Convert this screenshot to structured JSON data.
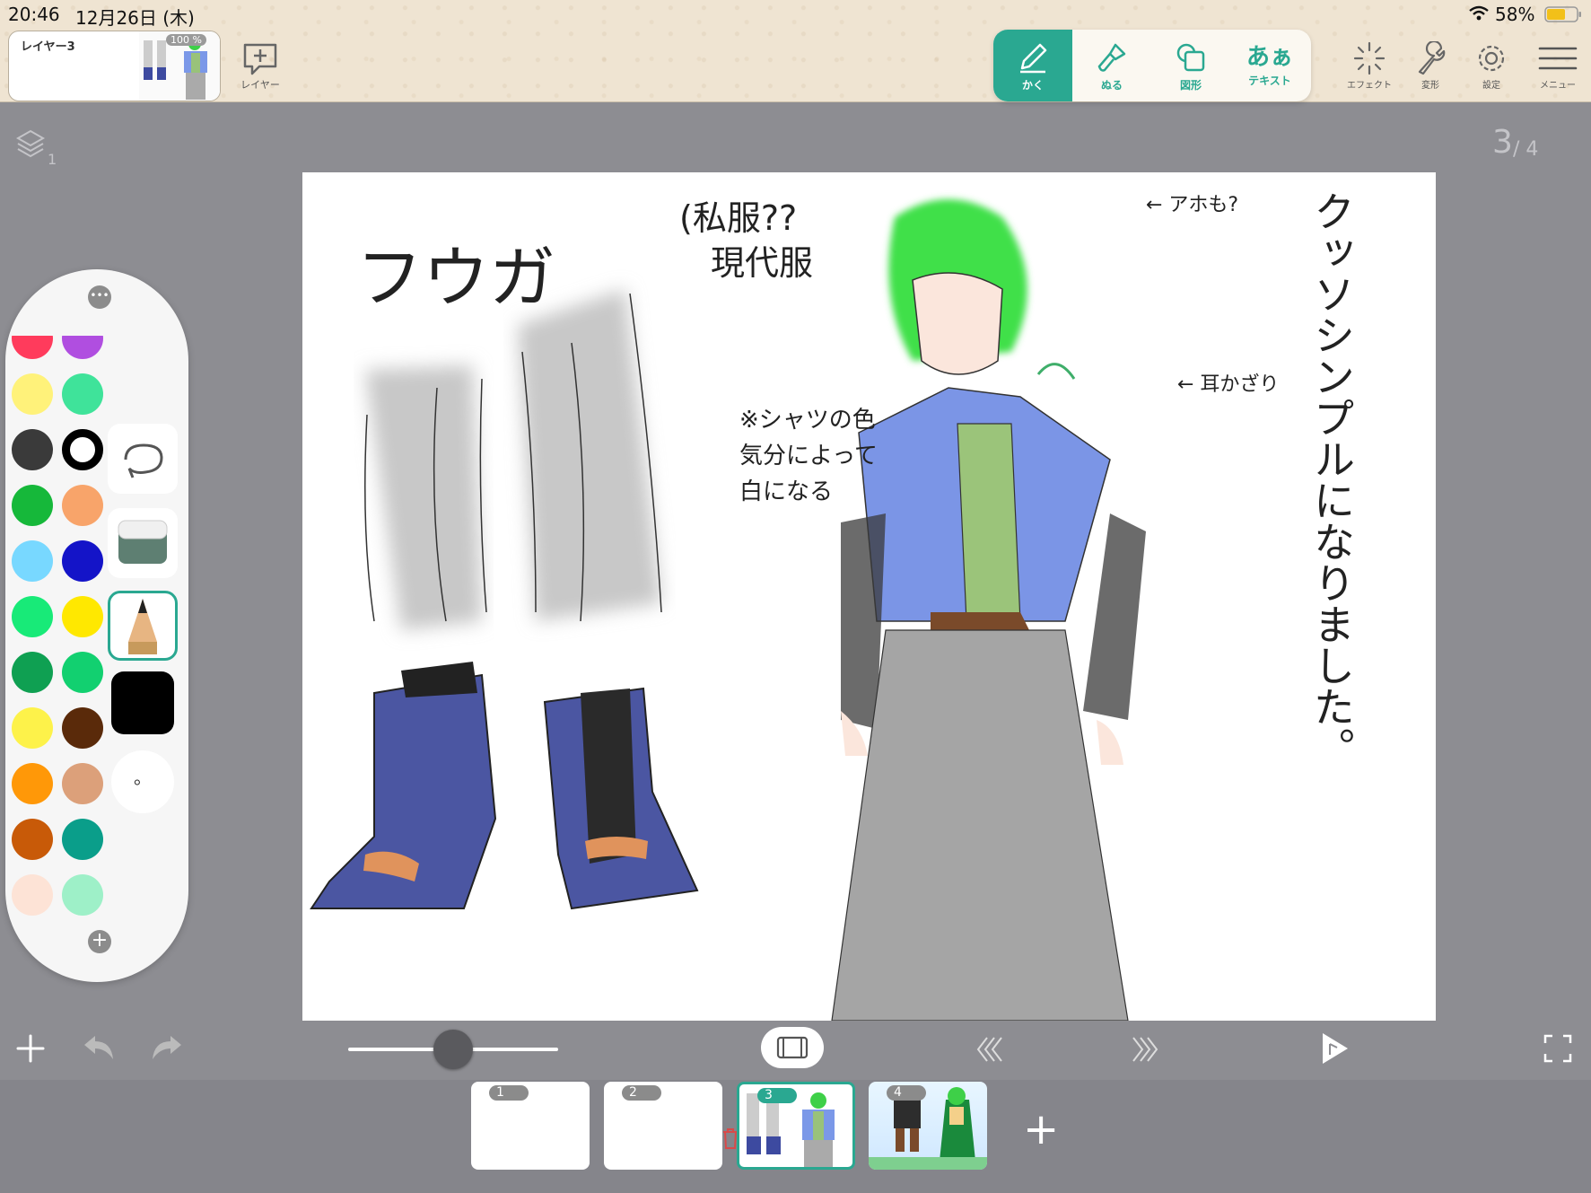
{
  "status": {
    "time": "20:46",
    "date": "12月26日 (木)",
    "battery": "58%"
  },
  "layer": {
    "name": "レイヤー3",
    "opacity": "100 %",
    "add_label": "レイヤー"
  },
  "tools": [
    {
      "label": "かく",
      "icon": "pencil-icon"
    },
    {
      "label": "ぬる",
      "icon": "brush-icon"
    },
    {
      "label": "図形",
      "icon": "shape-icon"
    },
    {
      "label": "テキスト",
      "icon": "text-icon",
      "glyph": "あぁ"
    }
  ],
  "right_tools": [
    {
      "label": "エフェクト",
      "icon": "sparkle-icon"
    },
    {
      "label": "変形",
      "icon": "wrench-icon"
    },
    {
      "label": "設定",
      "icon": "gear-icon"
    },
    {
      "label": "メニュー",
      "icon": "menu-icon"
    }
  ],
  "layer_count": "1",
  "page": {
    "current": "3",
    "total": "/ 4"
  },
  "canvas_text": {
    "name": "フウガ",
    "clothes": "(私服??",
    "modern": "現代服",
    "ahoge": "← アホも?",
    "earring": "← 耳かざり",
    "shirt_note_1": "※シャツの色",
    "shirt_note_2": "気分によって",
    "shirt_note_3": "白になる",
    "vertical": "クッソシンプルになりました。"
  },
  "palette": {
    "colors": [
      "#ff3b5c",
      "#b04ee0",
      "#fff27a",
      "#3fe39a",
      "#3a3a3a",
      "#ffffff",
      "#16b83a",
      "#f8a46a",
      "#78d8ff",
      "#1414c8",
      "#18ea78",
      "#ffe800",
      "#0fa052",
      "#12d070",
      "#fdf24a",
      "#5a2a0a",
      "#ff9808",
      "#dca07a",
      "#c85a08",
      "#0a9e8a",
      "#fde3d6",
      "#9ef0c8"
    ],
    "current_size": "。"
  },
  "timeline": {
    "frames": [
      "1",
      "2",
      "3",
      "4"
    ],
    "add_label": "+"
  },
  "accent": "#2aa891"
}
